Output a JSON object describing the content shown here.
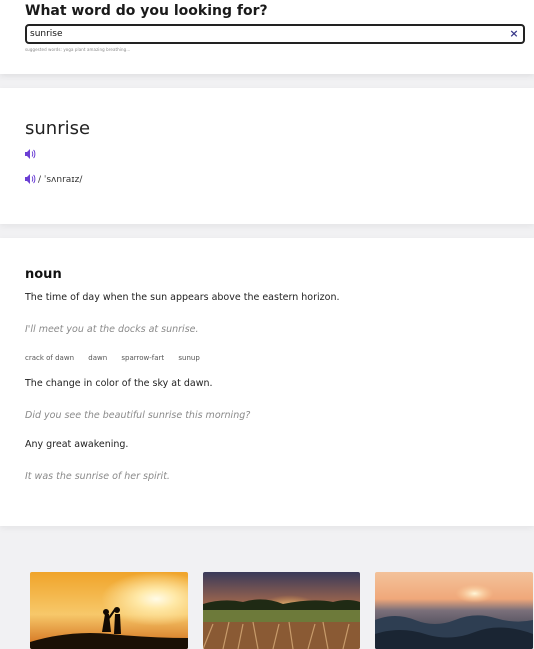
{
  "search": {
    "prompt": "What word do you looking for?",
    "value": "sunrise",
    "clear_label": "×",
    "suggestions": "suggested words: yoga  plant  amazing  breathing..."
  },
  "entry": {
    "word": "sunrise",
    "phonetic": "/ ˈsʌnraɪz/"
  },
  "meanings": {
    "part_of_speech": "noun",
    "definitions": [
      {
        "text": "The time of day when the sun appears above the eastern horizon.",
        "example": "I'll meet you at the docks at sunrise."
      },
      {
        "text": "The change in color of the sky at dawn.",
        "example": "Did you see the beautiful sunrise this morning?"
      },
      {
        "text": "Any great awakening.",
        "example": "It was the sunrise of her spirit."
      }
    ],
    "synonyms": [
      "crack of dawn",
      "dawn",
      "sparrow-fart",
      "sunup"
    ]
  },
  "icons": {
    "speaker": "speaker-icon",
    "clear": "close-icon"
  },
  "colors": {
    "accent": "#6b3fd4",
    "background": "#f1f1f3"
  }
}
